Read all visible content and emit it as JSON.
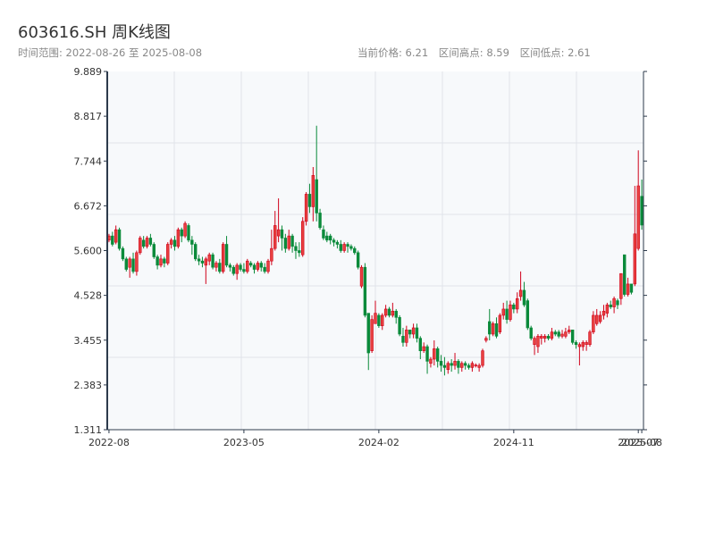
{
  "header": {
    "title": "603616.SH 周K线图",
    "range_label": "时间范围: 2022-08-26 至 2025-08-08",
    "range_start": "2022-08-26",
    "current_price": "当前价格: 6.21",
    "range_high": "区间高点: 8.59",
    "range_low": "区间低点: 2.61"
  },
  "colors": {
    "up": "#d0021b",
    "up_fill": "#e8413f",
    "down": "#0a8a3a",
    "background": "#f7f9fb",
    "grid": "#e1e4ea",
    "axis": "#2c3a4b"
  },
  "chart_data": {
    "type": "candlestick",
    "frequency": "weekly",
    "ylim": [
      1.311,
      9.889
    ],
    "yticks": [
      "9.889",
      "8.817",
      "7.744",
      "6.672",
      "5.600",
      "4.528",
      "3.455",
      "2.383",
      "1.311"
    ],
    "xticks": [
      {
        "label": "2022-08",
        "index": 0
      },
      {
        "label": "2023-05",
        "index": 39
      },
      {
        "label": "2024-02",
        "index": 78
      },
      {
        "label": "2024-11",
        "index": 117
      },
      {
        "label": "2025-07",
        "index": 153
      },
      {
        "label": "2025-08",
        "index": 154
      }
    ],
    "grid": true,
    "candle_fields": [
      "open",
      "close",
      "low",
      "high"
    ],
    "candles": [
      [
        5.85,
        5.95,
        5.8,
        6.0
      ],
      [
        5.95,
        5.75,
        5.7,
        6.05
      ],
      [
        5.8,
        6.1,
        5.75,
        6.2
      ],
      [
        6.1,
        5.65,
        5.6,
        6.15
      ],
      [
        5.65,
        5.4,
        5.35,
        5.7
      ],
      [
        5.4,
        5.15,
        5.1,
        5.45
      ],
      [
        5.2,
        5.4,
        4.95,
        5.45
      ],
      [
        5.4,
        5.1,
        5.05,
        5.55
      ],
      [
        5.1,
        5.55,
        5.0,
        5.6
      ],
      [
        5.55,
        5.9,
        5.5,
        5.95
      ],
      [
        5.85,
        5.7,
        5.65,
        5.95
      ],
      [
        5.7,
        5.9,
        5.65,
        5.95
      ],
      [
        5.9,
        5.75,
        5.7,
        6.0
      ],
      [
        5.75,
        5.45,
        5.4,
        5.8
      ],
      [
        5.45,
        5.25,
        5.15,
        5.5
      ],
      [
        5.25,
        5.4,
        5.2,
        5.5
      ],
      [
        5.4,
        5.3,
        5.2,
        5.45
      ],
      [
        5.3,
        5.75,
        5.25,
        5.8
      ],
      [
        5.75,
        5.85,
        5.65,
        5.9
      ],
      [
        5.85,
        5.7,
        5.6,
        5.95
      ],
      [
        5.7,
        6.1,
        5.65,
        6.15
      ],
      [
        6.1,
        5.95,
        5.8,
        6.15
      ],
      [
        5.95,
        6.25,
        5.9,
        6.3
      ],
      [
        6.2,
        5.85,
        5.8,
        6.25
      ],
      [
        5.85,
        5.75,
        5.5,
        5.95
      ],
      [
        5.75,
        5.4,
        5.35,
        5.8
      ],
      [
        5.4,
        5.35,
        5.25,
        5.5
      ],
      [
        5.35,
        5.3,
        5.2,
        5.45
      ],
      [
        5.25,
        5.4,
        4.8,
        5.45
      ],
      [
        5.35,
        5.5,
        5.25,
        5.55
      ],
      [
        5.5,
        5.2,
        5.15,
        5.55
      ],
      [
        5.2,
        5.3,
        5.1,
        5.35
      ],
      [
        5.3,
        5.1,
        5.05,
        5.4
      ],
      [
        5.1,
        5.75,
        5.05,
        5.8
      ],
      [
        5.75,
        5.25,
        5.2,
        5.95
      ],
      [
        5.25,
        5.2,
        5.1,
        5.3
      ],
      [
        5.2,
        5.05,
        5.0,
        5.25
      ],
      [
        5.05,
        5.25,
        4.9,
        5.3
      ],
      [
        5.25,
        5.15,
        5.1,
        5.3
      ],
      [
        5.15,
        5.1,
        5.05,
        5.3
      ],
      [
        5.1,
        5.35,
        5.05,
        5.4
      ],
      [
        5.3,
        5.25,
        5.2,
        5.35
      ],
      [
        5.25,
        5.15,
        5.05,
        5.3
      ],
      [
        5.15,
        5.3,
        5.1,
        5.35
      ],
      [
        5.3,
        5.2,
        5.1,
        5.35
      ],
      [
        5.2,
        5.1,
        5.05,
        5.3
      ],
      [
        5.1,
        5.35,
        5.05,
        5.4
      ],
      [
        5.35,
        5.65,
        5.25,
        6.1
      ],
      [
        5.65,
        6.2,
        5.6,
        6.55
      ],
      [
        5.95,
        6.1,
        5.8,
        6.85
      ],
      [
        6.1,
        5.9,
        5.6,
        6.2
      ],
      [
        5.9,
        5.65,
        5.55,
        6.0
      ],
      [
        5.65,
        5.95,
        5.6,
        6.1
      ],
      [
        5.95,
        5.7,
        5.55,
        6.0
      ],
      [
        5.7,
        5.6,
        5.4,
        5.8
      ],
      [
        5.6,
        5.55,
        5.45,
        5.8
      ],
      [
        5.5,
        6.3,
        5.45,
        6.4
      ],
      [
        6.3,
        6.95,
        6.2,
        7.0
      ],
      [
        6.95,
        6.65,
        6.5,
        7.2
      ],
      [
        6.65,
        7.4,
        6.3,
        7.6
      ],
      [
        7.3,
        6.5,
        6.3,
        8.59
      ],
      [
        6.5,
        6.15,
        6.1,
        6.6
      ],
      [
        6.1,
        5.9,
        5.85,
        6.2
      ],
      [
        5.95,
        5.85,
        5.8,
        6.05
      ],
      [
        5.95,
        5.85,
        5.75,
        6.0
      ],
      [
        5.85,
        5.8,
        5.7,
        5.9
      ],
      [
        5.8,
        5.75,
        5.65,
        5.85
      ],
      [
        5.75,
        5.6,
        5.55,
        5.85
      ],
      [
        5.6,
        5.75,
        5.55,
        5.8
      ],
      [
        5.75,
        5.7,
        5.55,
        5.8
      ],
      [
        5.7,
        5.65,
        5.6,
        5.75
      ],
      [
        5.65,
        5.55,
        5.5,
        5.7
      ],
      [
        5.55,
        5.2,
        5.15,
        5.6
      ],
      [
        4.75,
        5.2,
        4.7,
        5.25
      ],
      [
        5.2,
        4.05,
        4.0,
        5.3
      ],
      [
        4.1,
        3.15,
        2.74,
        4.1
      ],
      [
        3.2,
        3.95,
        3.15,
        4.05
      ],
      [
        3.85,
        4.1,
        3.85,
        4.4
      ],
      [
        4.05,
        3.8,
        3.75,
        4.1
      ],
      [
        3.8,
        4.05,
        3.7,
        4.1
      ],
      [
        4.05,
        4.2,
        4.0,
        4.3
      ],
      [
        4.2,
        4.05,
        4.0,
        4.25
      ],
      [
        4.05,
        4.15,
        4.0,
        4.35
      ],
      [
        4.15,
        4.0,
        3.85,
        4.2
      ],
      [
        4.0,
        3.6,
        3.55,
        4.05
      ],
      [
        3.55,
        3.4,
        3.3,
        3.75
      ],
      [
        3.4,
        3.7,
        3.3,
        3.8
      ],
      [
        3.7,
        3.6,
        3.5,
        3.7
      ],
      [
        3.6,
        3.75,
        3.5,
        3.85
      ],
      [
        3.75,
        3.5,
        3.4,
        3.85
      ],
      [
        3.5,
        3.2,
        3.0,
        3.55
      ],
      [
        3.2,
        3.3,
        3.15,
        3.4
      ],
      [
        3.3,
        2.95,
        2.65,
        3.35
      ],
      [
        2.9,
        3.0,
        2.8,
        3.05
      ],
      [
        3.0,
        3.25,
        2.85,
        3.45
      ],
      [
        3.25,
        2.95,
        2.8,
        3.3
      ],
      [
        2.95,
        2.85,
        2.7,
        3.1
      ],
      [
        2.85,
        2.8,
        2.61,
        3.05
      ],
      [
        2.75,
        2.9,
        2.65,
        2.95
      ],
      [
        2.9,
        2.85,
        2.7,
        3.0
      ],
      [
        2.85,
        2.95,
        2.75,
        3.15
      ],
      [
        2.95,
        2.8,
        2.65,
        3.0
      ],
      [
        2.8,
        2.9,
        2.7,
        2.95
      ],
      [
        2.9,
        2.85,
        2.75,
        2.95
      ],
      [
        2.85,
        2.8,
        2.75,
        2.9
      ],
      [
        2.8,
        2.9,
        2.7,
        2.95
      ],
      [
        2.85,
        2.86,
        2.8,
        2.9
      ],
      [
        2.8,
        2.85,
        2.7,
        2.9
      ],
      [
        2.85,
        3.2,
        2.8,
        3.25
      ],
      [
        3.45,
        3.5,
        3.4,
        3.55
      ],
      [
        3.9,
        3.6,
        3.45,
        4.2
      ],
      [
        3.6,
        3.85,
        3.55,
        3.9
      ],
      [
        3.85,
        3.55,
        3.5,
        4.0
      ],
      [
        3.65,
        4.05,
        3.6,
        4.1
      ],
      [
        4.05,
        4.2,
        3.95,
        4.35
      ],
      [
        4.2,
        3.95,
        3.85,
        4.4
      ],
      [
        3.95,
        4.3,
        3.9,
        4.4
      ],
      [
        4.3,
        4.2,
        4.1,
        4.35
      ],
      [
        4.2,
        4.45,
        4.1,
        4.6
      ],
      [
        4.5,
        4.65,
        4.4,
        5.1
      ],
      [
        4.65,
        4.3,
        4.25,
        4.85
      ],
      [
        4.4,
        3.75,
        3.7,
        4.45
      ],
      [
        3.75,
        3.5,
        3.45,
        3.8
      ],
      [
        3.35,
        3.5,
        3.1,
        3.55
      ],
      [
        3.3,
        3.55,
        3.15,
        3.6
      ],
      [
        3.5,
        3.55,
        3.35,
        3.6
      ],
      [
        3.5,
        3.55,
        3.4,
        3.6
      ],
      [
        3.55,
        3.5,
        3.45,
        3.6
      ],
      [
        3.5,
        3.65,
        3.45,
        3.75
      ],
      [
        3.65,
        3.6,
        3.55,
        3.7
      ],
      [
        3.65,
        3.55,
        3.5,
        3.7
      ],
      [
        3.55,
        3.6,
        3.5,
        3.7
      ],
      [
        3.55,
        3.65,
        3.5,
        3.75
      ],
      [
        3.65,
        3.7,
        3.6,
        3.8
      ],
      [
        3.7,
        3.4,
        3.35,
        3.7
      ],
      [
        3.4,
        3.35,
        3.25,
        3.45
      ],
      [
        3.3,
        3.35,
        2.85,
        3.4
      ],
      [
        3.3,
        3.4,
        3.2,
        3.45
      ],
      [
        3.35,
        3.4,
        3.2,
        3.45
      ],
      [
        3.35,
        3.65,
        3.3,
        3.7
      ],
      [
        3.65,
        4.05,
        3.6,
        4.15
      ],
      [
        3.85,
        4.05,
        3.8,
        4.2
      ],
      [
        3.9,
        4.05,
        3.85,
        4.15
      ],
      [
        4.05,
        4.15,
        3.95,
        4.3
      ],
      [
        4.1,
        4.3,
        4.0,
        4.35
      ],
      [
        4.3,
        4.25,
        4.2,
        4.4
      ],
      [
        4.25,
        4.45,
        4.1,
        4.5
      ],
      [
        4.4,
        4.3,
        4.2,
        4.45
      ],
      [
        4.45,
        5.05,
        4.3,
        5.05
      ],
      [
        5.5,
        4.55,
        4.5,
        5.5
      ],
      [
        4.55,
        4.8,
        4.5,
        4.95
      ],
      [
        4.8,
        4.6,
        4.55,
        4.8
      ],
      [
        4.8,
        6.0,
        4.75,
        7.15
      ],
      [
        5.65,
        7.15,
        5.6,
        8.0
      ],
      [
        6.9,
        6.21,
        6.1,
        7.3
      ]
    ]
  }
}
